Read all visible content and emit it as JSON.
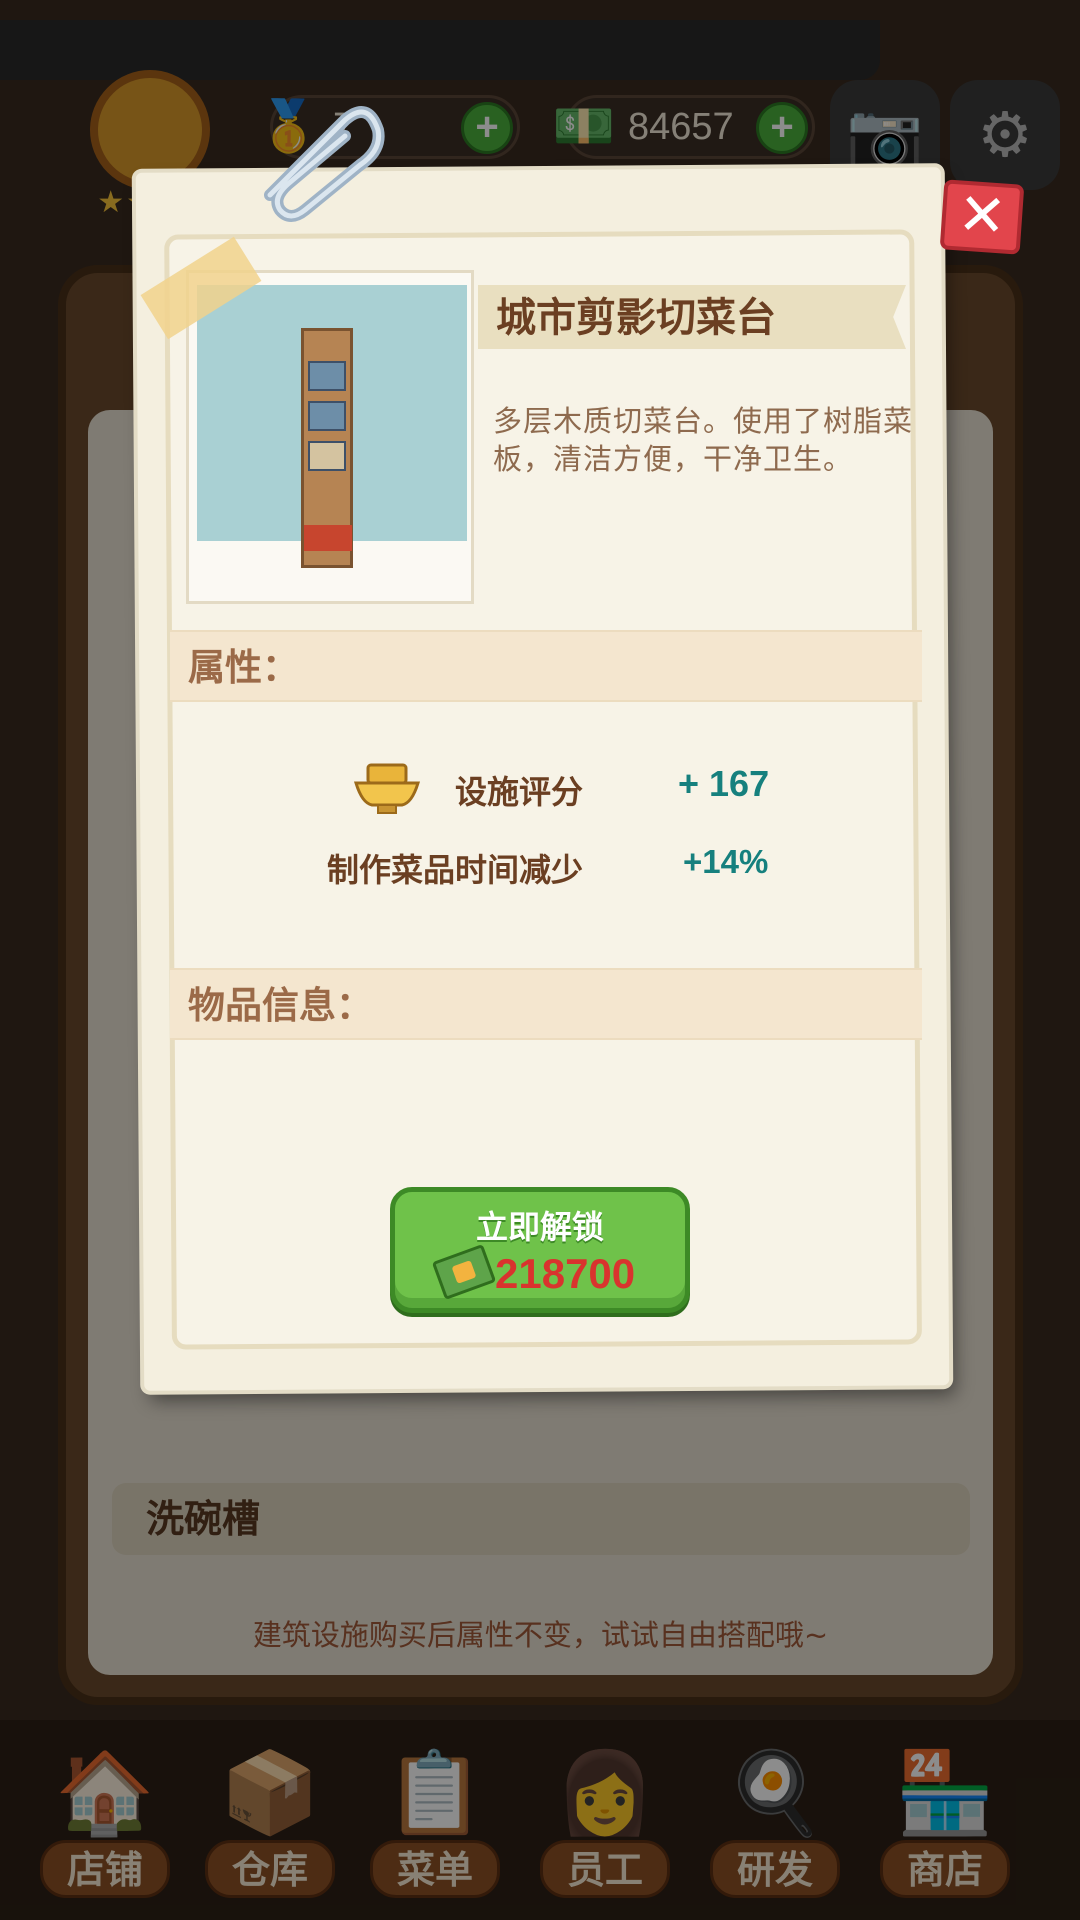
{
  "hud": {
    "currency_gold": "7",
    "currency_cash": "84657",
    "stars": "★★★★"
  },
  "background": {
    "panel_row_label": "洗碗槽",
    "hint_text": "建筑设施购买后属性不变，试试自由搭配哦~"
  },
  "nav": [
    {
      "label": "店铺",
      "icon": "shop-icon"
    },
    {
      "label": "仓库",
      "icon": "warehouse-icon"
    },
    {
      "label": "菜单",
      "icon": "menu-icon"
    },
    {
      "label": "员工",
      "icon": "staff-icon"
    },
    {
      "label": "研发",
      "icon": "research-icon"
    },
    {
      "label": "商店",
      "icon": "store-icon"
    }
  ],
  "modal": {
    "title": "城市剪影切菜台",
    "description": "多层木质切菜台。使用了树脂菜板，清洁方便，干净卫生。",
    "attributes_header": "属性：",
    "attributes": [
      {
        "label": "设施评分",
        "value": "+ 167"
      },
      {
        "label": "制作菜品时间减少",
        "value": "+14%"
      }
    ],
    "info_header": "物品信息：",
    "unlock_button": {
      "label": "立即解锁",
      "price": "218700"
    }
  },
  "colors": {
    "accent_green": "#6fc24a",
    "price_red": "#d9332e",
    "value_teal": "#16807e",
    "title_brown": "#6b3f22",
    "close_red": "#e2454c"
  }
}
